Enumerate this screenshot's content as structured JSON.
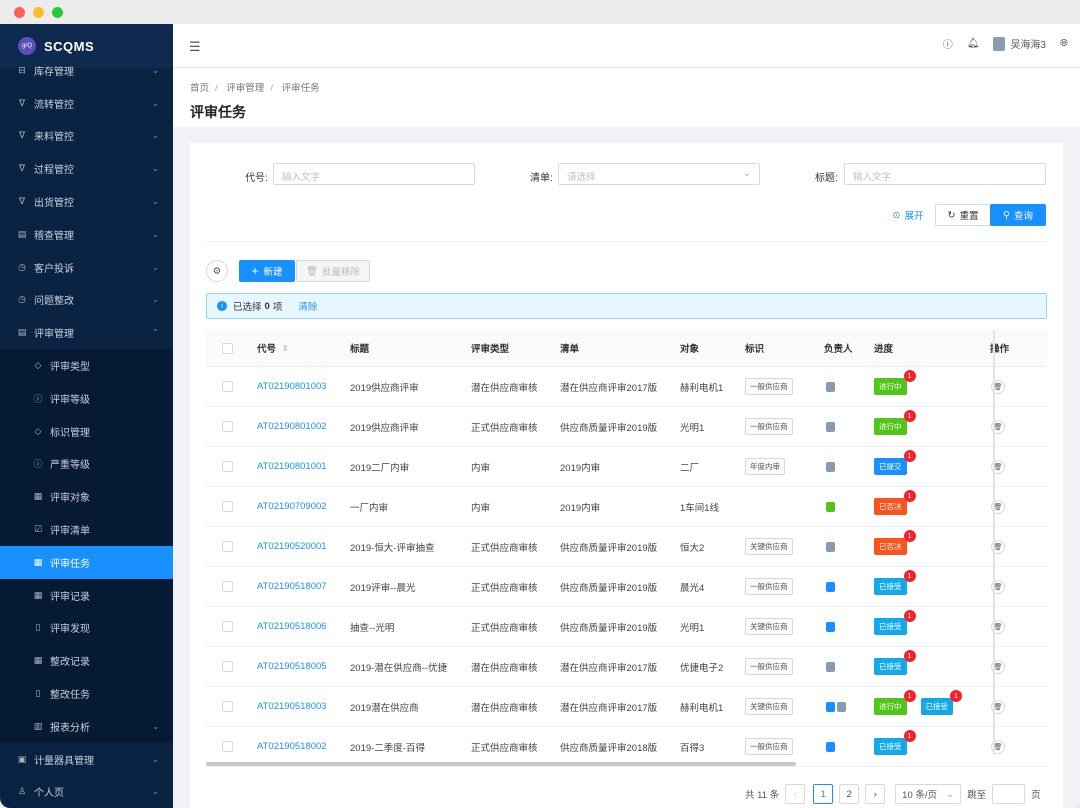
{
  "app": {
    "name": "SCQMS",
    "logo_text": "grQ"
  },
  "sidebar": {
    "top": [
      {
        "label": "库存管理",
        "icon": "lock-icon"
      },
      {
        "label": "流转管控",
        "icon": "filter-icon"
      },
      {
        "label": "来料管控",
        "icon": "filter-icon"
      },
      {
        "label": "过程管控",
        "icon": "filter-icon"
      },
      {
        "label": "出货管控",
        "icon": "filter-icon"
      },
      {
        "label": "稽查管理",
        "icon": "doc-icon"
      },
      {
        "label": "客户投诉",
        "icon": "clock-icon"
      },
      {
        "label": "问题整改",
        "icon": "clock-icon"
      },
      {
        "label": "评审管理",
        "icon": "doc-icon"
      }
    ],
    "sub": [
      {
        "label": "评审类型",
        "icon": "tag-icon"
      },
      {
        "label": "评审等级",
        "icon": "info-icon"
      },
      {
        "label": "标识管理",
        "icon": "tag-icon"
      },
      {
        "label": "严重等级",
        "icon": "info-icon"
      },
      {
        "label": "评审对象",
        "icon": "table-icon"
      },
      {
        "label": "评审清单",
        "icon": "check-icon"
      },
      {
        "label": "评审任务",
        "icon": "table-icon"
      },
      {
        "label": "评审记录",
        "icon": "table-icon"
      },
      {
        "label": "评审发现",
        "icon": "file-icon"
      },
      {
        "label": "整改记录",
        "icon": "table-icon"
      },
      {
        "label": "整改任务",
        "icon": "file-icon"
      },
      {
        "label": "报表分析",
        "icon": "chart-icon"
      }
    ],
    "bottom": [
      {
        "label": "计量器具管理",
        "icon": "grid-icon"
      },
      {
        "label": "个人页",
        "icon": "user-icon"
      }
    ]
  },
  "header": {
    "user": "吴海海3"
  },
  "breadcrumb": [
    "首页",
    "评审管理",
    "评审任务"
  ],
  "page_title": "评审任务",
  "filters": {
    "code_label": "代号:",
    "code_placeholder": "输入文字",
    "list_label": "清单:",
    "list_placeholder": "请选择",
    "title_label": "标题:",
    "title_placeholder": "输入文字",
    "expand": "展开",
    "reset": "重置",
    "query": "查询"
  },
  "toolbar": {
    "new": "新建",
    "batch_remove": "批量移除"
  },
  "selection": {
    "prefix": "已选择",
    "count": "0",
    "suffix": "项",
    "clear": "清除"
  },
  "table": {
    "headers": {
      "code": "代号",
      "title": "标题",
      "type": "评审类型",
      "list": "清单",
      "object": "对象",
      "mark": "标识",
      "owner": "负责人",
      "progress": "进度",
      "action": "操作"
    },
    "rows": [
      {
        "code": "AT02190801003",
        "title": "2019供应商评审",
        "type": "潜在供应商审核",
        "list": "潜在供应商评审2017版",
        "object": "赫利电机1",
        "mark": "一般供应商",
        "progress": [
          {
            "text": "进行中",
            "color": "#52c41a",
            "badge": "1"
          }
        ],
        "owner": [
          "grey"
        ]
      },
      {
        "code": "AT02190801002",
        "title": "2019供应商评审",
        "type": "正式供应商审核",
        "list": "供应商质量评审2019版",
        "object": "光明1",
        "mark": "一般供应商",
        "progress": [
          {
            "text": "进行中",
            "color": "#52c41a",
            "badge": "1"
          }
        ],
        "owner": [
          "grey"
        ]
      },
      {
        "code": "AT02190801001",
        "title": "2019二厂内审",
        "type": "内审",
        "list": "2019内审",
        "object": "二厂",
        "mark": "年度内审",
        "progress": [
          {
            "text": "已提交",
            "color": "#1890ff",
            "badge": "1"
          }
        ],
        "owner": [
          "grey"
        ]
      },
      {
        "code": "AT02190709002",
        "title": "一厂内审",
        "type": "内审",
        "list": "2019内审",
        "object": "1车间1线",
        "mark": "",
        "progress": [
          {
            "text": "已否决",
            "color": "#fa541c",
            "badge": "1"
          }
        ],
        "owner": [
          "green"
        ]
      },
      {
        "code": "AT02190520001",
        "title": "2019-恒大-评审抽查",
        "type": "正式供应商审核",
        "list": "供应商质量评审2019版",
        "object": "恒大2",
        "mark": "关键供应商",
        "progress": [
          {
            "text": "已否决",
            "color": "#fa541c",
            "badge": "1"
          }
        ],
        "owner": [
          "grey"
        ]
      },
      {
        "code": "AT02190518007",
        "title": "2019评审--晨光",
        "type": "正式供应商审核",
        "list": "供应商质量评审2019版",
        "object": "晨光4",
        "mark": "一般供应商",
        "progress": [
          {
            "text": "已接受",
            "color": "#13a8e8",
            "badge": "1"
          }
        ],
        "owner": [
          "blue"
        ]
      },
      {
        "code": "AT02190518006",
        "title": "抽查--光明",
        "type": "正式供应商审核",
        "list": "供应商质量评审2019版",
        "object": "光明1",
        "mark": "关键供应商",
        "progress": [
          {
            "text": "已接受",
            "color": "#13a8e8",
            "badge": "1"
          }
        ],
        "owner": [
          "blue"
        ]
      },
      {
        "code": "AT02190518005",
        "title": "2019-潜在供应商--优捷",
        "type": "潜在供应商审核",
        "list": "潜在供应商评审2017版",
        "object": "优捷电子2",
        "mark": "一般供应商",
        "progress": [
          {
            "text": "已接受",
            "color": "#13a8e8",
            "badge": "1"
          }
        ],
        "owner": [
          "grey"
        ]
      },
      {
        "code": "AT02190518003",
        "title": "2019潜在供应商",
        "type": "潜在供应商审核",
        "list": "潜在供应商评审2017版",
        "object": "赫利电机1",
        "mark": "关键供应商",
        "progress": [
          {
            "text": "进行中",
            "color": "#52c41a",
            "badge": "1"
          },
          {
            "text": "已接受",
            "color": "#13a8e8",
            "badge": "1"
          }
        ],
        "owner": [
          "blue",
          "grey"
        ]
      },
      {
        "code": "AT02190518002",
        "title": "2019-二季度-百得",
        "type": "正式供应商审核",
        "list": "供应商质量评审2018版",
        "object": "百得3",
        "mark": "一般供应商",
        "progress": [
          {
            "text": "已接受",
            "color": "#13a8e8",
            "badge": "1"
          }
        ],
        "owner": [
          "blue"
        ]
      }
    ]
  },
  "pagination": {
    "total": "共 11 条",
    "pages": [
      "1",
      "2"
    ],
    "size": "10 条/页",
    "jump": "跳至",
    "page_unit": "页"
  }
}
